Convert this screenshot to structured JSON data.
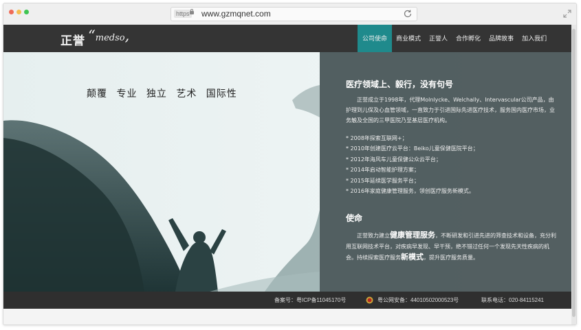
{
  "browser": {
    "https_label": "https",
    "url": "www.gzmqnet.com",
    "dot_colors": [
      "#ef6b57",
      "#f5be4f",
      "#3fc552"
    ]
  },
  "site": {
    "logo_cn": "正誉",
    "logo_en": "medso",
    "accent_color": "#1f8a8c",
    "nav": [
      {
        "label": "公司使命",
        "active": true
      },
      {
        "label": "商业模式",
        "active": false
      },
      {
        "label": "正誉人",
        "active": false
      },
      {
        "label": "合作孵化",
        "active": false
      },
      {
        "label": "品牌故事",
        "active": false
      },
      {
        "label": "加入我们",
        "active": false
      }
    ]
  },
  "hero": {
    "slogan": "颠覆 专业 独立 艺术 国际性"
  },
  "panel": {
    "heading": "医疗领域上、毅行，没有句号",
    "intro": "正誉成立于1998年，代理Molnlycke、Welchally、Intervascular公司产品，由护理到儿保及心血管领域，一直致力于引进国际先进医疗技术，服务国内医疗市场，业务触及全国的三甲医院乃至基层医疗机构。",
    "milestones": [
      "* 2008年探索互联网+；",
      "* 2010年创建医疗云平台：Beiko儿童保健医院平台；",
      "* 2012年海风车儿童保健公众云平台；",
      "* 2014年启动智能护理方案；",
      "* 2015年延续医学服务平台；",
      "* 2016年家庭健康管理服务，领创医疗服务新模式。"
    ],
    "mission_heading": "使命",
    "mission_p1": "正誉致力建立",
    "mission_big1": "健康管理服务",
    "mission_p2": "，不断研发和引进先进的筛查技术和设备，充分利用互联网技术平台，对疾病早发现、早干预，绝不错过任何一个发现先天性疾病的机会。持续探索医疗服务",
    "mission_big2": "新模式",
    "mission_p3": "，提升医疗服务质量。"
  },
  "footer": {
    "icp": "备案号：粤ICP备11045170号",
    "police": "粤公网安备：44010502000523号",
    "phone": "联系电话：020-84115241"
  }
}
